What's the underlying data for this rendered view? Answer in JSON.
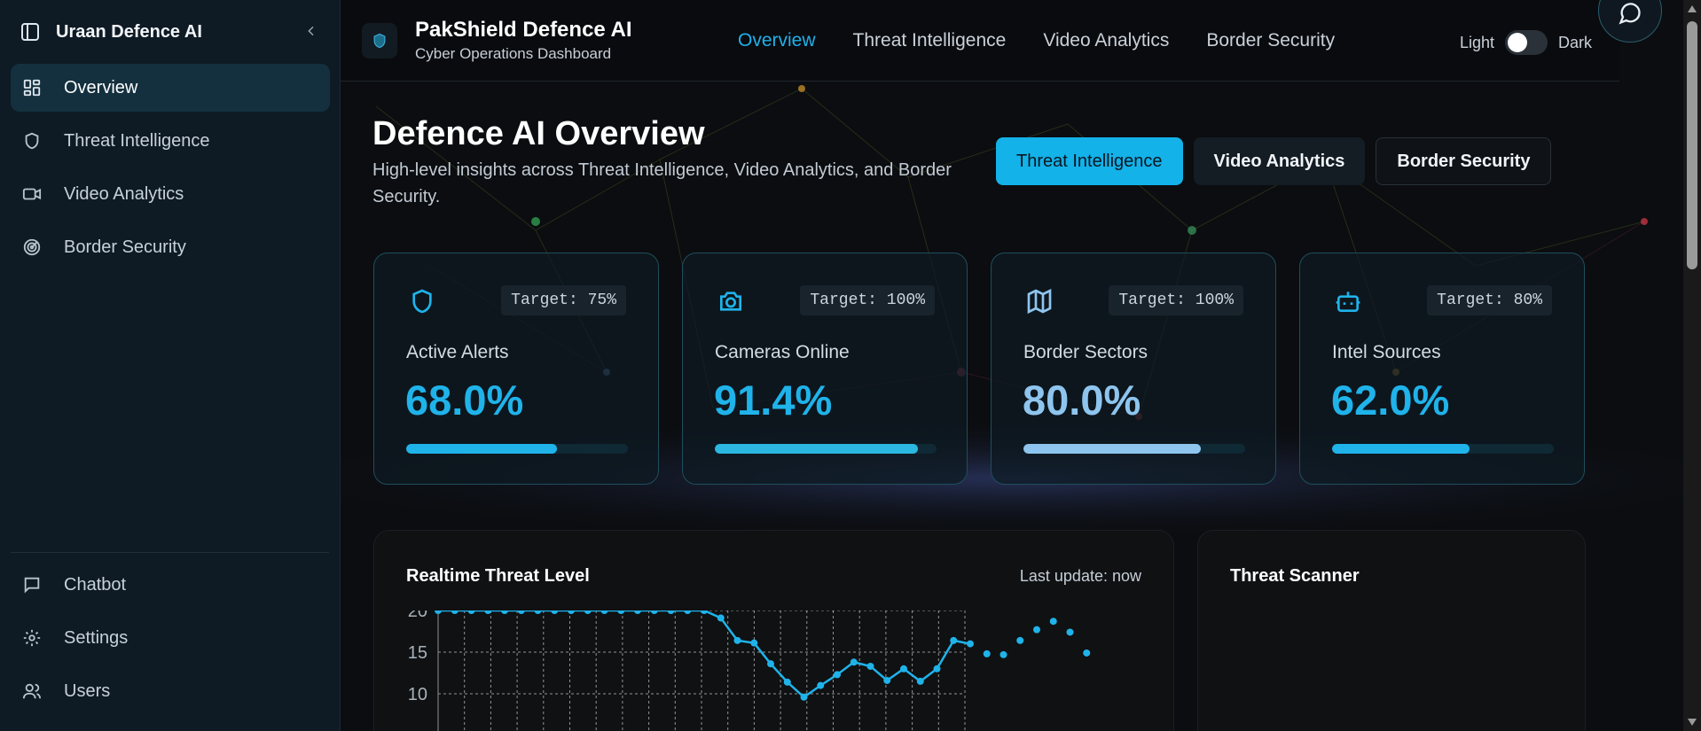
{
  "sidebar": {
    "brand": "Uraan Defence AI",
    "items": [
      {
        "label": "Overview",
        "icon": "dashboard-icon",
        "active": true
      },
      {
        "label": "Threat Intelligence",
        "icon": "shield-icon"
      },
      {
        "label": "Video Analytics",
        "icon": "video-icon"
      },
      {
        "label": "Border Security",
        "icon": "radar-icon"
      }
    ],
    "bottom": [
      {
        "label": "Chatbot",
        "icon": "message-icon"
      },
      {
        "label": "Settings",
        "icon": "gear-icon"
      },
      {
        "label": "Users",
        "icon": "users-icon"
      }
    ]
  },
  "header": {
    "title": "PakShield Defence AI",
    "subtitle": "Cyber Operations Dashboard",
    "nav": [
      "Overview",
      "Threat Intelligence",
      "Video Analytics",
      "Border Security"
    ],
    "theme_light": "Light",
    "theme_dark": "Dark"
  },
  "hero": {
    "title": "Defence AI Overview",
    "subtitle": "High-level insights across Threat Intelligence, Video Analytics, and Border Security.",
    "buttons": [
      "Threat Intelligence",
      "Video Analytics",
      "Border Security"
    ]
  },
  "cards": [
    {
      "icon": "shield-icon",
      "target": "Target: 75%",
      "label": "Active Alerts",
      "value": "68.0%",
      "progress": 0.68,
      "color": "#1fb3ea"
    },
    {
      "icon": "camera-icon",
      "target": "Target: 100%",
      "label": "Cameras Online",
      "value": "91.4%",
      "progress": 0.914,
      "color": "#2bb7e0"
    },
    {
      "icon": "map-icon",
      "target": "Target: 100%",
      "label": "Border Sectors",
      "value": "80.0%",
      "progress": 0.8,
      "color": "#8ec5ee"
    },
    {
      "icon": "bot-icon",
      "target": "Target: 80%",
      "label": "Intel Sources",
      "value": "62.0%",
      "progress": 0.62,
      "color": "#1fb3ea"
    }
  ],
  "panels": {
    "chart_title": "Realtime Threat Level",
    "last_update": "Last update: now",
    "scanner_title": "Threat Scanner"
  },
  "chart_data": {
    "type": "line",
    "ytick_labels": [
      "20",
      "15",
      "10"
    ],
    "ylim": [
      10,
      20
    ],
    "series_values": [
      20,
      20,
      20,
      20,
      20,
      20,
      20,
      20,
      20,
      20,
      20,
      20,
      20,
      20,
      20,
      20,
      20,
      19.1,
      16.4,
      16.1,
      13.6,
      11.4,
      9.6,
      11.0,
      12.3,
      13.8,
      13.3,
      11.6,
      13.0,
      11.5,
      13.0,
      16.4,
      16.0
    ],
    "dots_values": [
      14.8,
      14.7,
      16.4,
      17.7,
      18.7,
      17.4,
      14.9
    ],
    "grid": true,
    "color": "#1fb3ea"
  },
  "colors": {
    "accent": "#1fb3ea",
    "sidebar_bg": "#0e1a24",
    "page_bg": "#0b0d10"
  }
}
